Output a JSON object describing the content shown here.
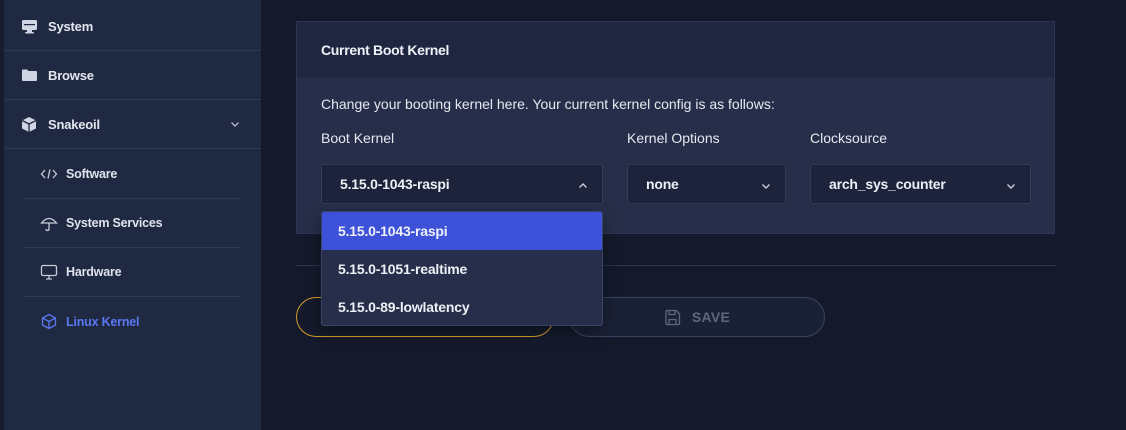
{
  "sidebar": {
    "items": [
      {
        "label": "System",
        "icon": "monitor-icon"
      },
      {
        "label": "Browse",
        "icon": "folder-icon"
      },
      {
        "label": "Snakeoil",
        "icon": "cube-icon",
        "expanded": true
      }
    ],
    "sub_items": [
      {
        "label": "Software",
        "icon": "code-icon"
      },
      {
        "label": "System Services",
        "icon": "umbrella-icon"
      },
      {
        "label": "Hardware",
        "icon": "monitor-icon"
      },
      {
        "label": "Linux Kernel",
        "icon": "cube-icon",
        "active": true
      }
    ]
  },
  "card": {
    "title": "Current Boot Kernel",
    "description": "Change your booting kernel here. Your current kernel config is as follows:",
    "boot_kernel": {
      "label": "Boot Kernel",
      "value": "5.15.0-1043-raspi"
    },
    "kernel_options": {
      "label": "Kernel Options",
      "value": "none"
    },
    "clocksource": {
      "label": "Clocksource",
      "value": "arch_sys_counter"
    }
  },
  "dropdown": {
    "options": [
      "5.15.0-1043-raspi",
      "5.15.0-1051-realtime",
      "5.15.0-89-lowlatency"
    ],
    "selected_index": 0
  },
  "buttons": {
    "save_label": "SAVE"
  },
  "colors": {
    "accent": "#3d52d9",
    "active_nav": "#5a77f2",
    "warning_outline": "#d79a2b"
  }
}
